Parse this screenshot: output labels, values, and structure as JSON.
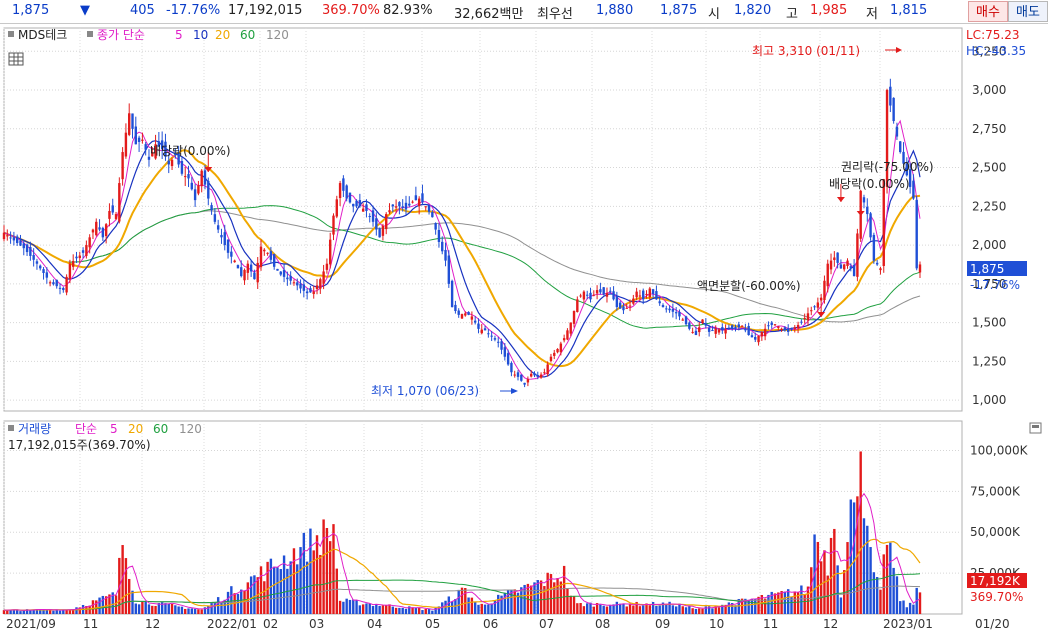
{
  "top_bar": {
    "price": "1,875",
    "change_arrow": "▼",
    "change": "405",
    "change_pct": "-17.76%",
    "volume": "17,192,015",
    "volume_ratio": "369.70%",
    "turnover_ratio": "82.93%",
    "trade_value": "32,662백만",
    "best_ask_label": "최우선",
    "best_ask": "1,880",
    "best_bid": "1,875",
    "open_label": "시",
    "open": "1,820",
    "high_label": "고",
    "high": "1,985",
    "low_label": "저",
    "low": "1,815",
    "buy_button": "매수",
    "sell_button": "매도"
  },
  "price_panel": {
    "stock_name": "MDS테크",
    "legend_label": "종가 단순",
    "ma_periods": [
      "5",
      "10",
      "20",
      "60",
      "120"
    ],
    "lc": "LC:75.23",
    "hc": "HC:-43.35",
    "annotations": {
      "high": "최고 3,310 (01/11)",
      "low": "최저 1,070 (06/23)",
      "dividend_1": "배당락(0.00%)",
      "split": "액면분할(-60.00%)",
      "rights": "권리락(-75.00%)",
      "dividend_2": "배당락(0.00%)"
    },
    "price_tag": "1,875",
    "pct_tag": "-17.76%"
  },
  "volume_panel": {
    "legend_label": "거래량",
    "legend_ma": "단순",
    "ma_periods": [
      "5",
      "20",
      "60",
      "120"
    ],
    "volume_info": "17,192,015주(369.70%)",
    "volume_tag": "17,192K",
    "pct_tag": "369.70%"
  },
  "colors": {
    "up": "#e31b1b",
    "down": "#1f4fd6",
    "ma5": "#e020c8",
    "ma10": "#1832c0",
    "ma20": "#f0a800",
    "ma60": "#20a040",
    "ma120": "#909090"
  },
  "chart_data": {
    "type": "candlestick",
    "price_axis": {
      "ticks": [
        1000,
        1250,
        1500,
        1750,
        2000,
        2250,
        2500,
        2750,
        3000,
        3250
      ],
      "tick_labels": [
        "1,000",
        "1,250",
        "1,500",
        "1,750",
        "2,000",
        "2,250",
        "2,500",
        "2,750",
        "3,000",
        "3,250"
      ],
      "ylim": [
        930,
        3400
      ]
    },
    "volume_axis": {
      "ticks": [
        25000,
        50000,
        75000,
        100000
      ],
      "tick_labels": [
        "25,000K",
        "50,000K",
        "75,000K",
        "100,000K"
      ],
      "ylim": [
        0,
        118000
      ]
    },
    "x_labels": [
      "2021/09",
      "11",
      "12",
      "2022/01",
      "02",
      "03",
      "04",
      "05",
      "06",
      "07",
      "08",
      "09",
      "10",
      "11",
      "12",
      "2023/01",
      "01/20"
    ],
    "price_path": [
      [
        0,
        2080
      ],
      [
        6,
        1980
      ],
      [
        10,
        1880
      ],
      [
        14,
        1760
      ],
      [
        18,
        1710
      ],
      [
        20,
        1880
      ],
      [
        24,
        1950
      ],
      [
        28,
        2150
      ],
      [
        30,
        2050
      ],
      [
        32,
        2220
      ],
      [
        34,
        2200
      ],
      [
        36,
        2600
      ],
      [
        38,
        2850
      ],
      [
        40,
        2650
      ],
      [
        42,
        2680
      ],
      [
        44,
        2550
      ],
      [
        46,
        2650
      ],
      [
        48,
        2620
      ],
      [
        50,
        2520
      ],
      [
        52,
        2580
      ],
      [
        54,
        2460
      ],
      [
        56,
        2430
      ],
      [
        58,
        2290
      ],
      [
        60,
        2480
      ],
      [
        62,
        2300
      ],
      [
        64,
        2150
      ],
      [
        66,
        2050
      ],
      [
        68,
        1950
      ],
      [
        70,
        1900
      ],
      [
        72,
        1800
      ],
      [
        74,
        1880
      ],
      [
        76,
        1780
      ],
      [
        78,
        1990
      ],
      [
        80,
        1950
      ],
      [
        82,
        1860
      ],
      [
        84,
        1810
      ],
      [
        86,
        1780
      ],
      [
        88,
        1760
      ],
      [
        90,
        1720
      ],
      [
        92,
        1690
      ],
      [
        94,
        1700
      ],
      [
        96,
        1780
      ],
      [
        98,
        1880
      ],
      [
        100,
        2190
      ],
      [
        102,
        2400
      ],
      [
        104,
        2300
      ],
      [
        106,
        2250
      ],
      [
        108,
        2250
      ],
      [
        110,
        2220
      ],
      [
        112,
        2150
      ],
      [
        114,
        2050
      ],
      [
        116,
        2200
      ],
      [
        118,
        2250
      ],
      [
        120,
        2250
      ],
      [
        122,
        2230
      ],
      [
        124,
        2280
      ],
      [
        126,
        2300
      ],
      [
        128,
        2250
      ],
      [
        130,
        2180
      ],
      [
        132,
        2020
      ],
      [
        134,
        1900
      ],
      [
        136,
        1600
      ],
      [
        138,
        1550
      ],
      [
        140,
        1560
      ],
      [
        142,
        1540
      ],
      [
        144,
        1460
      ],
      [
        146,
        1450
      ],
      [
        148,
        1410
      ],
      [
        150,
        1370
      ],
      [
        152,
        1280
      ],
      [
        154,
        1180
      ],
      [
        156,
        1150
      ],
      [
        158,
        1100
      ],
      [
        160,
        1170
      ],
      [
        162,
        1150
      ],
      [
        164,
        1180
      ],
      [
        166,
        1280
      ],
      [
        168,
        1330
      ],
      [
        170,
        1400
      ],
      [
        172,
        1500
      ],
      [
        174,
        1650
      ],
      [
        176,
        1700
      ],
      [
        178,
        1650
      ],
      [
        180,
        1710
      ],
      [
        182,
        1680
      ],
      [
        184,
        1700
      ],
      [
        186,
        1600
      ],
      [
        188,
        1580
      ],
      [
        190,
        1610
      ],
      [
        192,
        1700
      ],
      [
        194,
        1650
      ],
      [
        196,
        1720
      ],
      [
        198,
        1650
      ],
      [
        200,
        1600
      ],
      [
        202,
        1580
      ],
      [
        204,
        1560
      ],
      [
        206,
        1520
      ],
      [
        208,
        1460
      ],
      [
        210,
        1420
      ],
      [
        212,
        1520
      ],
      [
        214,
        1440
      ],
      [
        216,
        1460
      ],
      [
        218,
        1450
      ],
      [
        220,
        1460
      ],
      [
        222,
        1460
      ],
      [
        224,
        1480
      ],
      [
        226,
        1420
      ],
      [
        228,
        1390
      ],
      [
        230,
        1440
      ],
      [
        232,
        1480
      ],
      [
        234,
        1490
      ],
      [
        236,
        1460
      ],
      [
        238,
        1440
      ],
      [
        240,
        1470
      ],
      [
        242,
        1500
      ],
      [
        244,
        1560
      ],
      [
        246,
        1600
      ],
      [
        248,
        1660
      ],
      [
        250,
        1880
      ],
      [
        252,
        1920
      ],
      [
        254,
        1850
      ],
      [
        256,
        1900
      ],
      [
        258,
        1800
      ],
      [
        260,
        2350
      ],
      [
        262,
        2200
      ],
      [
        264,
        1900
      ],
      [
        266,
        1850
      ],
      [
        268,
        3000
      ],
      [
        270,
        2800
      ],
      [
        272,
        2600
      ],
      [
        274,
        2450
      ],
      [
        276,
        2300
      ],
      [
        277,
        1850
      ],
      [
        278,
        1875
      ]
    ],
    "volume_path": [
      [
        0,
        2200
      ],
      [
        20,
        2800
      ],
      [
        34,
        12000
      ],
      [
        36,
        45000
      ],
      [
        38,
        28000
      ],
      [
        40,
        8000
      ],
      [
        60,
        2600
      ],
      [
        100,
        52000
      ],
      [
        102,
        8000
      ],
      [
        130,
        2500
      ],
      [
        140,
        15000
      ],
      [
        144,
        5000
      ],
      [
        170,
        25000
      ],
      [
        172,
        12000
      ],
      [
        174,
        6000
      ],
      [
        204,
        6000
      ],
      [
        210,
        2800
      ],
      [
        244,
        15000
      ],
      [
        246,
        48000
      ],
      [
        248,
        42000
      ],
      [
        250,
        30000
      ],
      [
        252,
        65000
      ],
      [
        254,
        12000
      ],
      [
        256,
        40000
      ],
      [
        258,
        80000
      ],
      [
        260,
        105000
      ],
      [
        262,
        45000
      ],
      [
        264,
        25000
      ],
      [
        266,
        12000
      ],
      [
        268,
        50000
      ],
      [
        270,
        28000
      ],
      [
        272,
        9000
      ],
      [
        274,
        5000
      ],
      [
        276,
        6000
      ],
      [
        277,
        16000
      ],
      [
        278,
        17192
      ]
    ]
  }
}
